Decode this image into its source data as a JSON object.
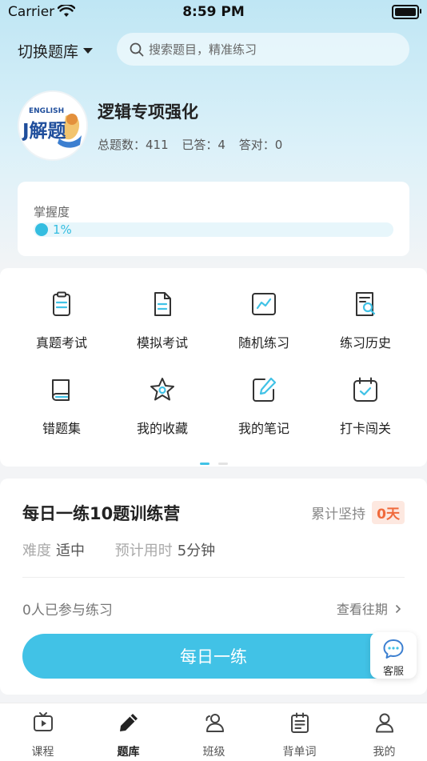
{
  "status_bar": {
    "carrier": "Carrier",
    "time": "8:59 PM"
  },
  "header": {
    "switch_bank": "切换题库",
    "search_placeholder": "搜索题目，精准练习"
  },
  "bank": {
    "logo_text": "ENGLISH",
    "logo_main": "J解题",
    "title": "逻辑专项强化",
    "total": "总题数：411",
    "answered": "已答：4",
    "correct": "答对：0"
  },
  "mastery": {
    "label": "掌握度",
    "percent_text": "1%",
    "percent": 0.01
  },
  "grid": [
    {
      "label": "真题考试",
      "icon": "clipboard-icon"
    },
    {
      "label": "模拟考试",
      "icon": "document-icon"
    },
    {
      "label": "随机练习",
      "icon": "chart-icon"
    },
    {
      "label": "练习历史",
      "icon": "history-search-icon"
    },
    {
      "label": "错题集",
      "icon": "book-icon"
    },
    {
      "label": "我的收藏",
      "icon": "star-icon"
    },
    {
      "label": "我的笔记",
      "icon": "note-edit-icon"
    },
    {
      "label": "打卡闯关",
      "icon": "calendar-check-icon"
    }
  ],
  "daily": {
    "title": "每日一练10题训练营",
    "streak_label": "累计坚持",
    "streak_value": "0天",
    "difficulty_label": "难度",
    "difficulty_value": "适中",
    "time_label": "预计用时",
    "time_value": "5分钟",
    "participants": "0人已参与练习",
    "history_link": "查看往期",
    "button": "每日一练"
  },
  "service": {
    "label": "客服"
  },
  "tabs": [
    {
      "label": "课程",
      "icon": "tv-play-icon"
    },
    {
      "label": "题库",
      "icon": "pencil-icon",
      "active": true
    },
    {
      "label": "班级",
      "icon": "group-icon"
    },
    {
      "label": "背单词",
      "icon": "vocab-list-icon"
    },
    {
      "label": "我的",
      "icon": "person-icon"
    }
  ],
  "colors": {
    "accent": "#41c2e6",
    "streak": "#f06a3c"
  }
}
